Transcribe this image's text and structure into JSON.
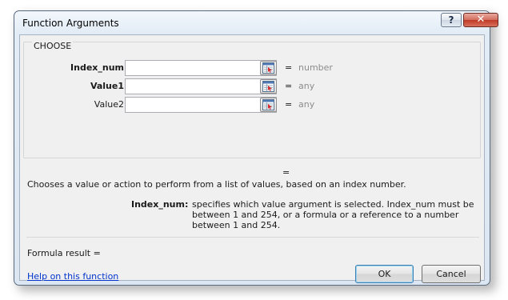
{
  "window": {
    "title": "Function Arguments",
    "help_glyph": "?",
    "close_glyph": "✕"
  },
  "function": {
    "name": "CHOOSE"
  },
  "args": [
    {
      "label": "Index_num",
      "bold": true,
      "value": "",
      "result": "number"
    },
    {
      "label": "Value1",
      "bold": true,
      "value": "",
      "result": "any"
    },
    {
      "label": "Value2",
      "bold": false,
      "value": "",
      "result": "any"
    }
  ],
  "equals_sign": "=",
  "description": "Chooses a value or action to perform from a list of values, based on an index number.",
  "arg_help": {
    "name": "Index_num:",
    "text": "specifies which value argument is selected. Index_num must be between 1 and 254, or a formula or a reference to a number between 1 and 254."
  },
  "formula_result_label": "Formula result =",
  "help_link": "Help on this function",
  "buttons": {
    "ok": "OK",
    "cancel": "Cancel"
  },
  "icons": {
    "help": "help-icon",
    "close": "close-icon",
    "ref": "collapse-dialog-icon"
  },
  "colors": {
    "close_button": "#c7402c",
    "link": "#0033cc",
    "result_gray": "#8c8c8c"
  }
}
